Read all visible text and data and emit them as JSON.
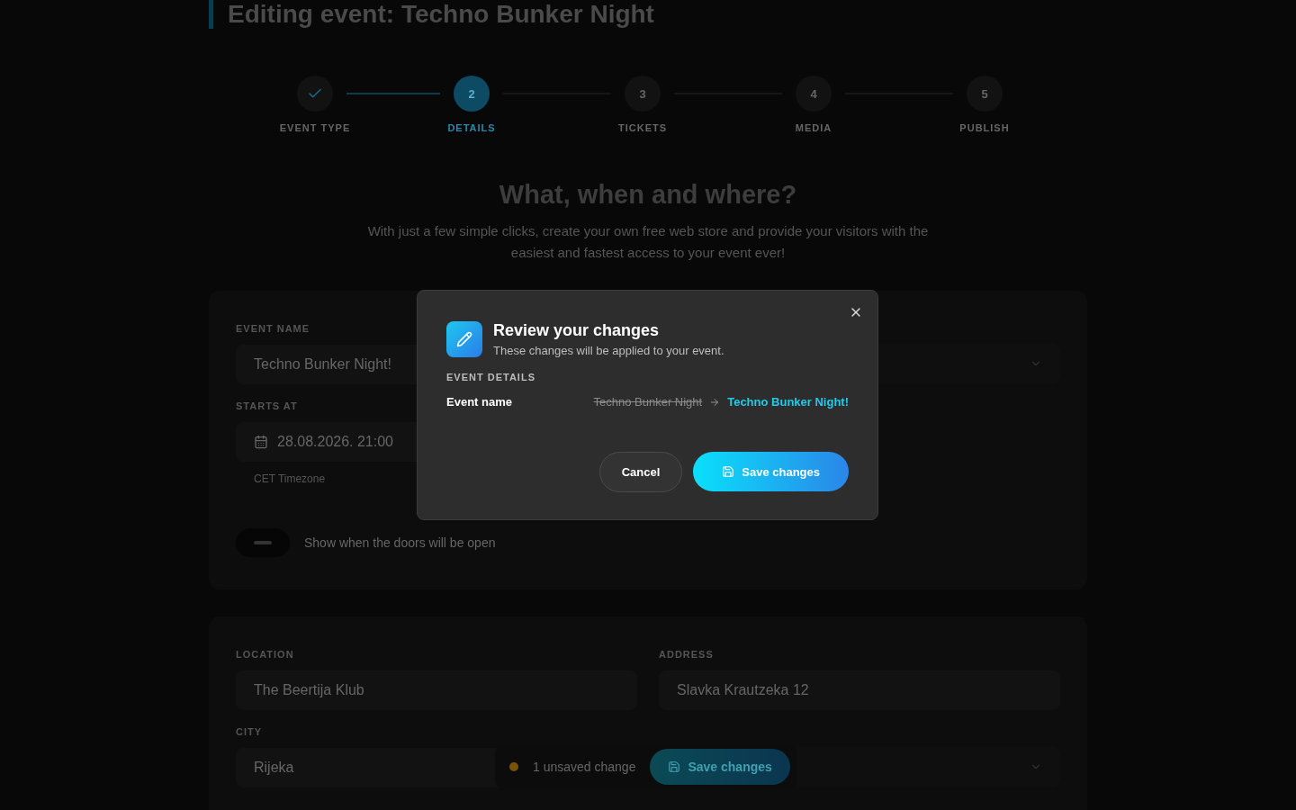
{
  "page_title": "Editing event: Techno Bunker Night",
  "steps": [
    {
      "label": "EVENT TYPE",
      "completed": true,
      "selected": false
    },
    {
      "number": "2",
      "label": "DETAILS",
      "completed": false,
      "selected": true
    },
    {
      "number": "3",
      "label": "TICKETS",
      "completed": false,
      "selected": false
    },
    {
      "number": "4",
      "label": "MEDIA",
      "completed": false,
      "selected": false
    },
    {
      "number": "5",
      "label": "PUBLISH",
      "completed": false,
      "selected": false
    }
  ],
  "heading": "What, when and where?",
  "intro": "With just a few simple clicks, create your own free web store and provide your visitors with the easiest and fastest access to your event ever!",
  "details_card": {
    "event_name": {
      "label": "EVENT NAME",
      "value": "Techno Bunker Night!"
    },
    "starts_at": {
      "label": "STARTS AT",
      "value": "28.08.2026. 21:00",
      "hint": "CET Timezone"
    },
    "doors_toggle": {
      "label": "Show when the doors will be open",
      "on": false
    }
  },
  "location_card": {
    "location": {
      "label": "LOCATION",
      "value": "The Beertija Klub"
    },
    "address": {
      "label": "ADDRESS",
      "value": "Slavka Krautzeka 12"
    },
    "city": {
      "label": "CITY",
      "value": "Rijeka"
    }
  },
  "unsaved_bar": {
    "count_text": "1 unsaved change",
    "button": "Save changes"
  },
  "modal": {
    "title": "Review your changes",
    "subtitle": "These changes will be applied to your event.",
    "section": "EVENT DETAILS",
    "changes": [
      {
        "field": "Event name",
        "old": "Techno Bunker Night",
        "new": "Techno Bunker Night!"
      }
    ],
    "cancel": "Cancel",
    "save": "Save changes"
  }
}
